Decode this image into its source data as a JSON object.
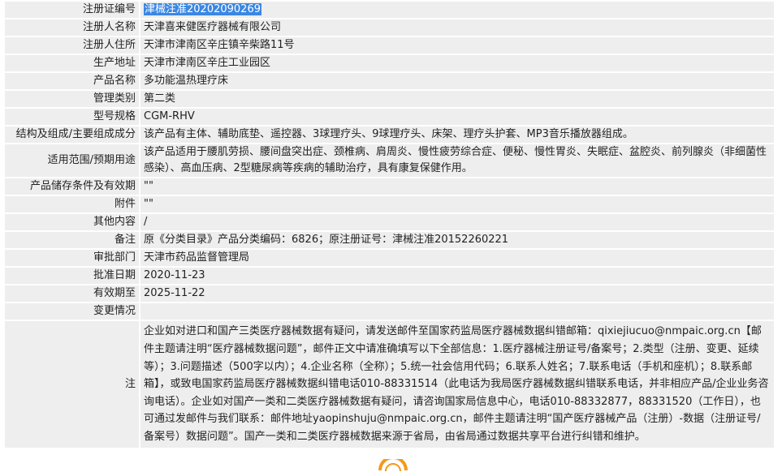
{
  "rows": [
    {
      "label": "注册证编号",
      "value": "津械注准20202090269",
      "highlight": true
    },
    {
      "label": "注册人名称",
      "value": "天津喜来健医疗器械有限公司"
    },
    {
      "label": "注册人住所",
      "value": "天津市津南区辛庄镇辛柴路11号"
    },
    {
      "label": "生产地址",
      "value": "天津市津南区辛庄工业园区"
    },
    {
      "label": "产品名称",
      "value": "多功能温热理疗床"
    },
    {
      "label": "管理类别",
      "value": "第二类"
    },
    {
      "label": "型号规格",
      "value": "CGM-RHV"
    },
    {
      "label": "结构及组成/主要组成成分",
      "value": "该产品有主体、辅助底垫、遥控器、3球理疗头、9球理疗头、床架、理疗头护套、MP3音乐播放器组成。"
    },
    {
      "label": "适用范围/预期用途",
      "value": "该产品适用于腰肌劳损、腰间盘突出症、颈椎病、肩周炎、慢性疲劳综合症、便秘、慢性胃炎、失眠症、盆腔炎、前列腺炎（非细菌性感染）、高血压病、2型糖尿病等疾病的辅助治疗，具有康复保健作用。"
    },
    {
      "label": "产品储存条件及有效期",
      "value": "\"\""
    },
    {
      "label": "附件",
      "value": "\"\""
    },
    {
      "label": "其他内容",
      "value": "/"
    },
    {
      "label": "备注",
      "value": "原《分类目录》产品分类编码：6826；原注册证号：津械注准20152260221"
    },
    {
      "label": "审批部门",
      "value": "天津市药品监督管理局"
    },
    {
      "label": "批准日期",
      "value": "2020-11-23"
    },
    {
      "label": "有效期至",
      "value": "2025-11-22"
    },
    {
      "label": "变更情况",
      "value": ""
    },
    {
      "label": "注",
      "value": "企业如对进口和国产三类医疗器械数据有疑问，请发送邮件至国家药监局医疗器械数据纠错邮箱：qixiejiucuo@nmpaic.org.cn【邮件主题请注明“医疗器械数据问题”，邮件正文中请准确填写以下全部信息：1.医疗器械注册证号/备案号；2.类型（注册、变更、延续等）；3.问题描述（500字以内）；4.企业名称（全称）；5.统一社会信用代码；6.联系人姓名；7.联系电话（手机和座机）；8.联系邮箱】，或致电国家药监局医疗器械数据纠错电话010-88331514（此电话为我局医疗器械数据纠错联系电话，并非相应产品/企业业务咨询电话）。企业如对国产一类和二类医疗器械数据有疑问，请咨询国家局信息中心，电话010-88332877，88331520（工作日），也可通过发邮件与我们联系：邮件地址yaopinshuju@nmpaic.org.cn，邮件主题请注明“国产医疗器械产品（注册）-数据（注册证号/备案号）数据问题”。国产一类和二类医疗器械数据来源于省局，由省局通过数据共享平台进行纠错和维护。"
    }
  ],
  "colors": {
    "cell_bg": "#eeeeee",
    "selection_bg": "#3b87e3",
    "logo_orange": "#f29a1d"
  },
  "icons": {
    "partial_logo": "orange-arc-logo-icon"
  }
}
